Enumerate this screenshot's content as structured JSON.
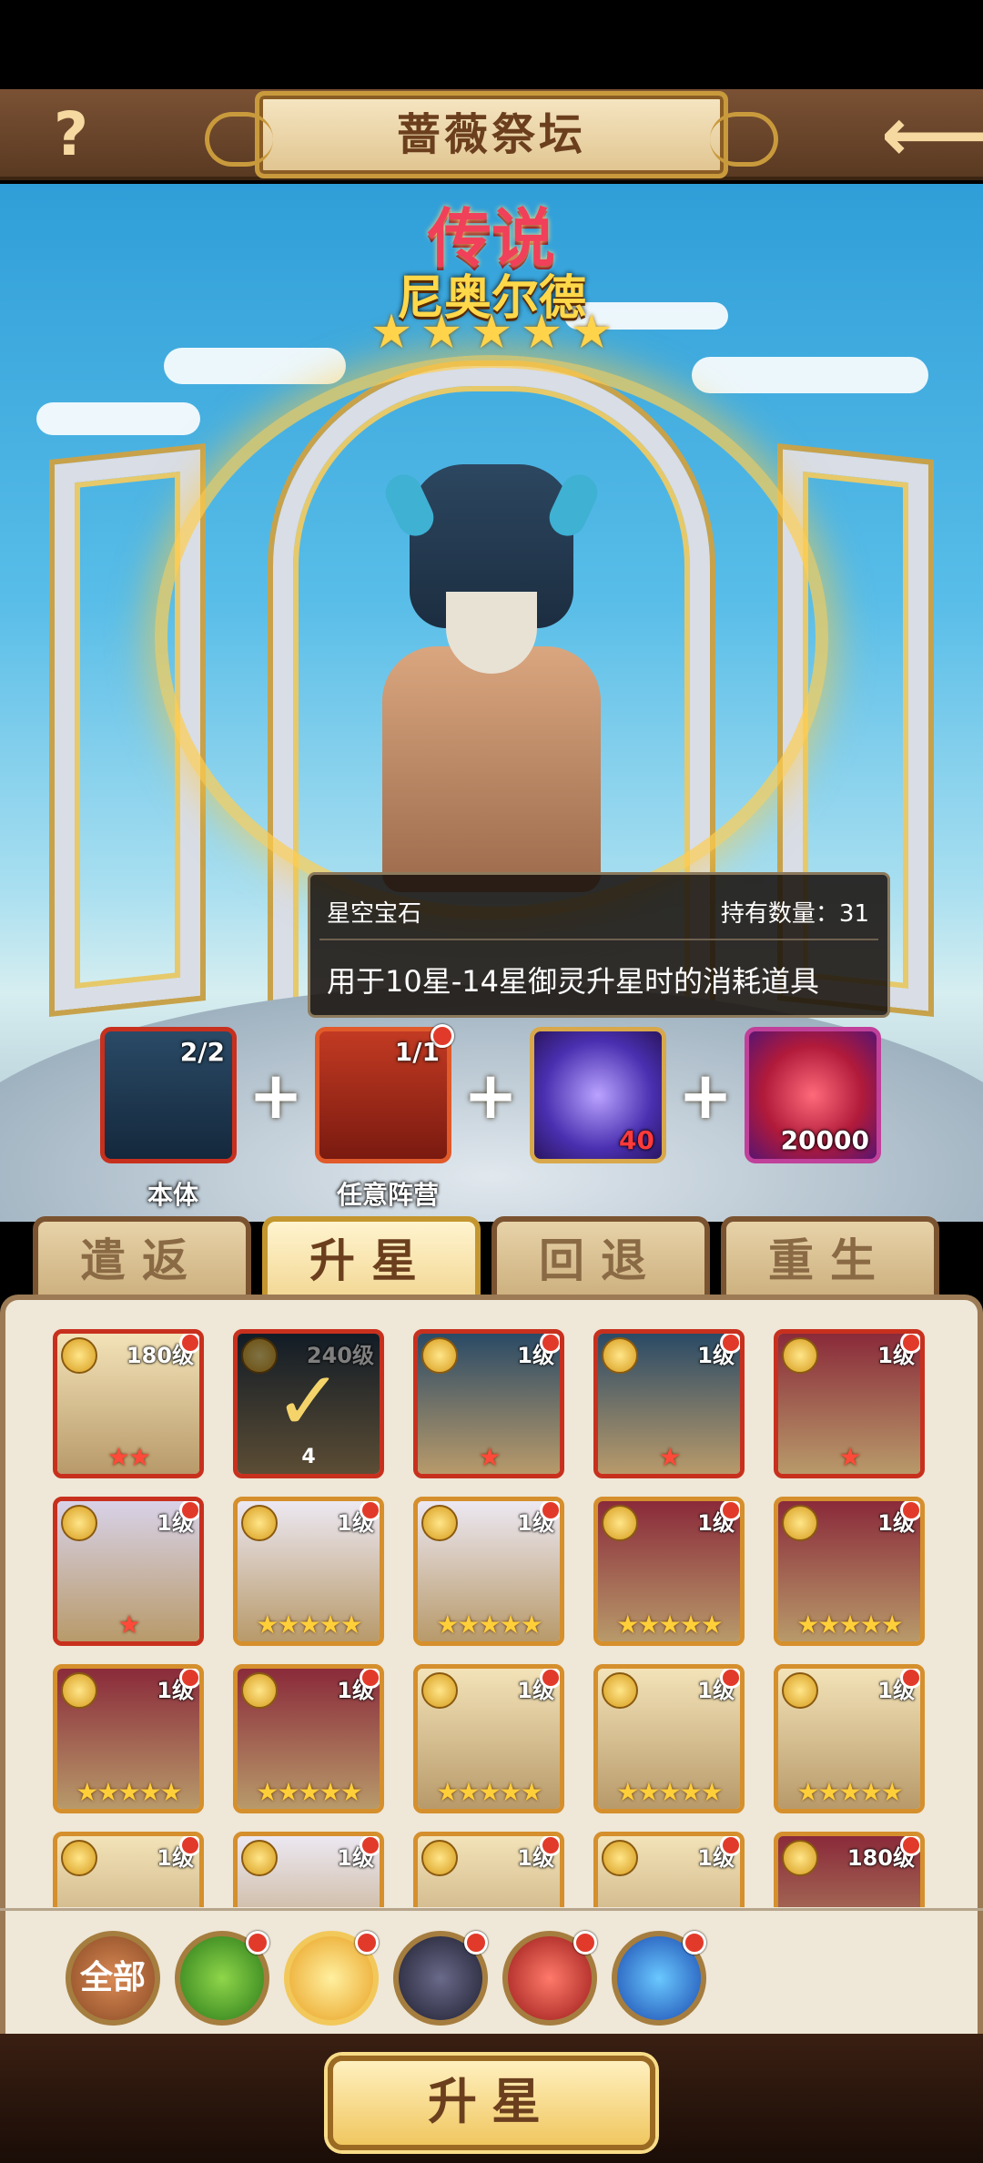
{
  "header": {
    "help_label": "?",
    "title": "蔷薇祭坛",
    "back_label": "back"
  },
  "hero": {
    "rarity": "传说",
    "name": "尼奥尔德",
    "stars": 5
  },
  "tooltip": {
    "item_name": "星空宝石",
    "count_label": "持有数量：31",
    "description": "用于10星-14星御灵升星时的消耗道具"
  },
  "materials": [
    {
      "label": "本体",
      "count": "2/2"
    },
    {
      "label": "任意阵营",
      "count": "1/1"
    },
    {
      "label": "",
      "count": "40"
    },
    {
      "label": "",
      "count": "20000"
    }
  ],
  "tabs": [
    {
      "label": "遣返",
      "active": false
    },
    {
      "label": "升星",
      "active": true
    },
    {
      "label": "回退",
      "active": false
    },
    {
      "label": "重生",
      "active": false
    }
  ],
  "cards": [
    {
      "level": "180级",
      "stars": "★★",
      "star_color": "red"
    },
    {
      "level": "240级",
      "stars": "",
      "selected": true,
      "sub": "4"
    },
    {
      "level": "1级",
      "stars": "★",
      "star_color": "red"
    },
    {
      "level": "1级",
      "stars": "★",
      "star_color": "red"
    },
    {
      "level": "1级",
      "stars": "★",
      "star_color": "red"
    },
    {
      "level": "1级",
      "stars": "★",
      "star_color": "red"
    },
    {
      "level": "1级",
      "stars": "★★★★★",
      "star_color": "gold"
    },
    {
      "level": "1级",
      "stars": "★★★★★",
      "star_color": "gold"
    },
    {
      "level": "1级",
      "stars": "★★★★★",
      "star_color": "gold"
    },
    {
      "level": "1级",
      "stars": "★★★★★",
      "star_color": "gold"
    },
    {
      "level": "1级",
      "stars": "★★★★★",
      "star_color": "gold"
    },
    {
      "level": "1级",
      "stars": "★★★★★",
      "star_color": "gold"
    },
    {
      "level": "1级",
      "stars": "★★★★★",
      "star_color": "gold"
    },
    {
      "level": "1级",
      "stars": "★★★★★",
      "star_color": "gold"
    },
    {
      "level": "1级",
      "stars": "★★★★★",
      "star_color": "gold"
    },
    {
      "level": "1级",
      "stars": "",
      "star_color": "gold"
    },
    {
      "level": "1级",
      "stars": "",
      "star_color": "gold"
    },
    {
      "level": "1级",
      "stars": "",
      "star_color": "gold"
    },
    {
      "level": "1级",
      "stars": "",
      "star_color": "gold"
    },
    {
      "level": "180级",
      "stars": "",
      "star_color": "gold"
    }
  ],
  "factions": [
    {
      "label": "全部",
      "icon": "all"
    },
    {
      "label": "",
      "icon": "wind-emblem-icon"
    },
    {
      "label": "",
      "icon": "rose-emblem-icon"
    },
    {
      "label": "",
      "icon": "star-emblem-icon"
    },
    {
      "label": "",
      "icon": "phoenix-emblem-icon"
    },
    {
      "label": "",
      "icon": "dragon-emblem-icon"
    }
  ],
  "action": {
    "upgrade_label": "升星"
  },
  "colors": {
    "gold": "#ffcf3a",
    "red_star": "#ff4a3a",
    "panel": "#efe7d7"
  }
}
